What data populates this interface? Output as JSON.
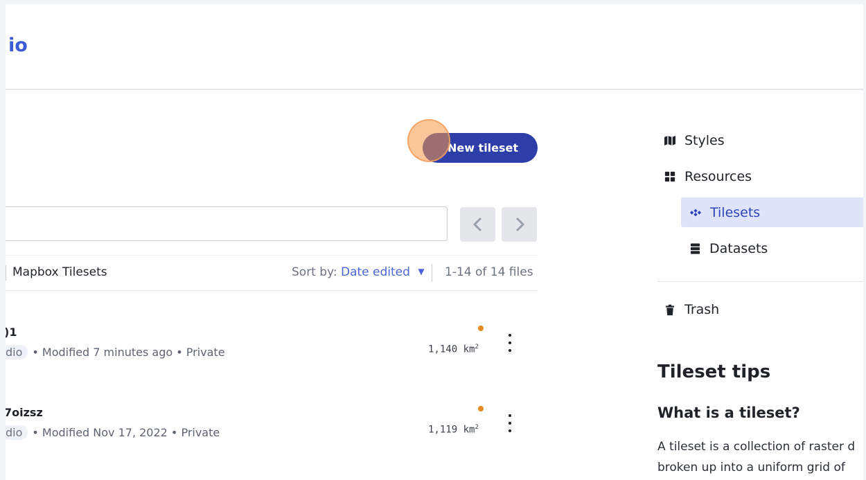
{
  "header": {
    "brand_text": "io"
  },
  "toolbar": {
    "new_tileset_label": "New tileset"
  },
  "search": {
    "value": "",
    "placeholder": ""
  },
  "pager": {
    "prev_icon": "chevron-left-icon",
    "next_icon": "chevron-right-icon"
  },
  "filters": {
    "tab_label": "Mapbox Tilesets",
    "sort_prefix": "Sort by:",
    "sort_value": "Date edited",
    "count": "1-14 of 14 files"
  },
  "tilesets": [
    {
      "name": ")1",
      "chip": "dio",
      "meta": "• Modified 7 minutes ago • Private",
      "area": "1,140",
      "unit": "km",
      "unit_sup": "2",
      "status_color": "#e48a22"
    },
    {
      "name": "7oizsz",
      "chip": "dio",
      "meta": "• Modified Nov 17, 2022 • Private",
      "area": "1,119",
      "unit": "km",
      "unit_sup": "2",
      "status_color": "#e48a22"
    }
  ],
  "sidebar": {
    "styles": "Styles",
    "resources": "Resources",
    "tilesets": "Tilesets",
    "datasets": "Datasets",
    "trash": "Trash"
  },
  "tips": {
    "title": "Tileset tips",
    "subtitle": "What is a tileset?",
    "line1": "A tileset is a collection of raster d",
    "line2": "broken up into a uniform grid of"
  },
  "colors": {
    "accent": "#2d3ea8",
    "link": "#4a65d6",
    "active_bg": "#dfe4fb"
  }
}
